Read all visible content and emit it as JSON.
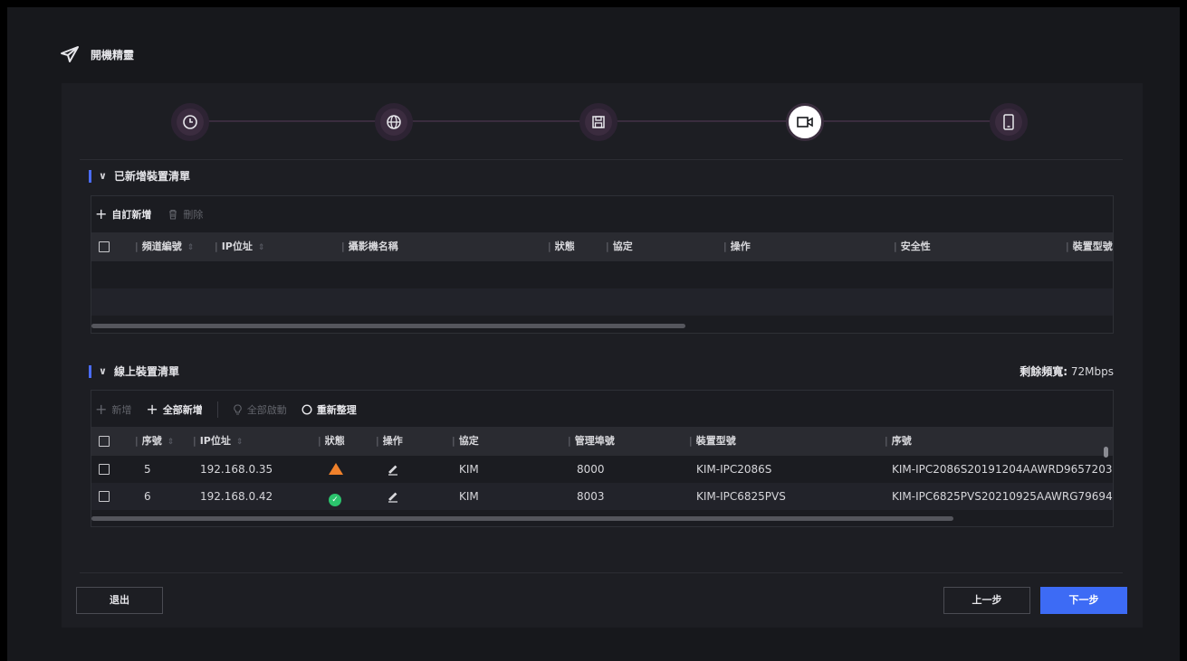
{
  "header": {
    "title": "開機精靈"
  },
  "steps": [
    {
      "icon": "clock-icon",
      "active": false
    },
    {
      "icon": "globe-icon",
      "active": false
    },
    {
      "icon": "save-icon",
      "active": false
    },
    {
      "icon": "camera-icon",
      "active": true
    },
    {
      "icon": "mobile-icon",
      "active": false
    }
  ],
  "added_list": {
    "title": "已新增裝置清單",
    "toolbar": {
      "custom_add": "自訂新增",
      "delete": "刪除"
    },
    "columns": [
      "頻道編號",
      "IP位址",
      "攝影機名稱",
      "狀態",
      "協定",
      "操作",
      "安全性",
      "裝置型號"
    ]
  },
  "online_list": {
    "title": "線上裝置清單",
    "bandwidth_label": "剩餘頻寬:",
    "bandwidth_value": "72Mbps",
    "toolbar": {
      "add": "新增",
      "add_all": "全部新增",
      "activate_all": "全部啟動",
      "refresh": "重新整理"
    },
    "columns": [
      "序號",
      "IP位址",
      "狀態",
      "操作",
      "協定",
      "管理埠號",
      "裝置型號",
      "序號"
    ],
    "rows": [
      {
        "no": "5",
        "ip": "192.168.0.35",
        "status": "warning",
        "protocol": "KIM",
        "port": "8000",
        "model": "KIM-IPC2086S",
        "serial": "KIM-IPC2086S20191204AAWRD9657203"
      },
      {
        "no": "6",
        "ip": "192.168.0.42",
        "status": "ok",
        "protocol": "KIM",
        "port": "8003",
        "model": "KIM-IPC6825PVS",
        "serial": "KIM-IPC6825PVS20210925AAWRG79694"
      }
    ]
  },
  "footer": {
    "exit": "退出",
    "prev": "上一步",
    "next": "下一步"
  },
  "colors": {
    "accent": "#3d6bf5",
    "warning": "#f0812b",
    "ok": "#2bc46d"
  }
}
